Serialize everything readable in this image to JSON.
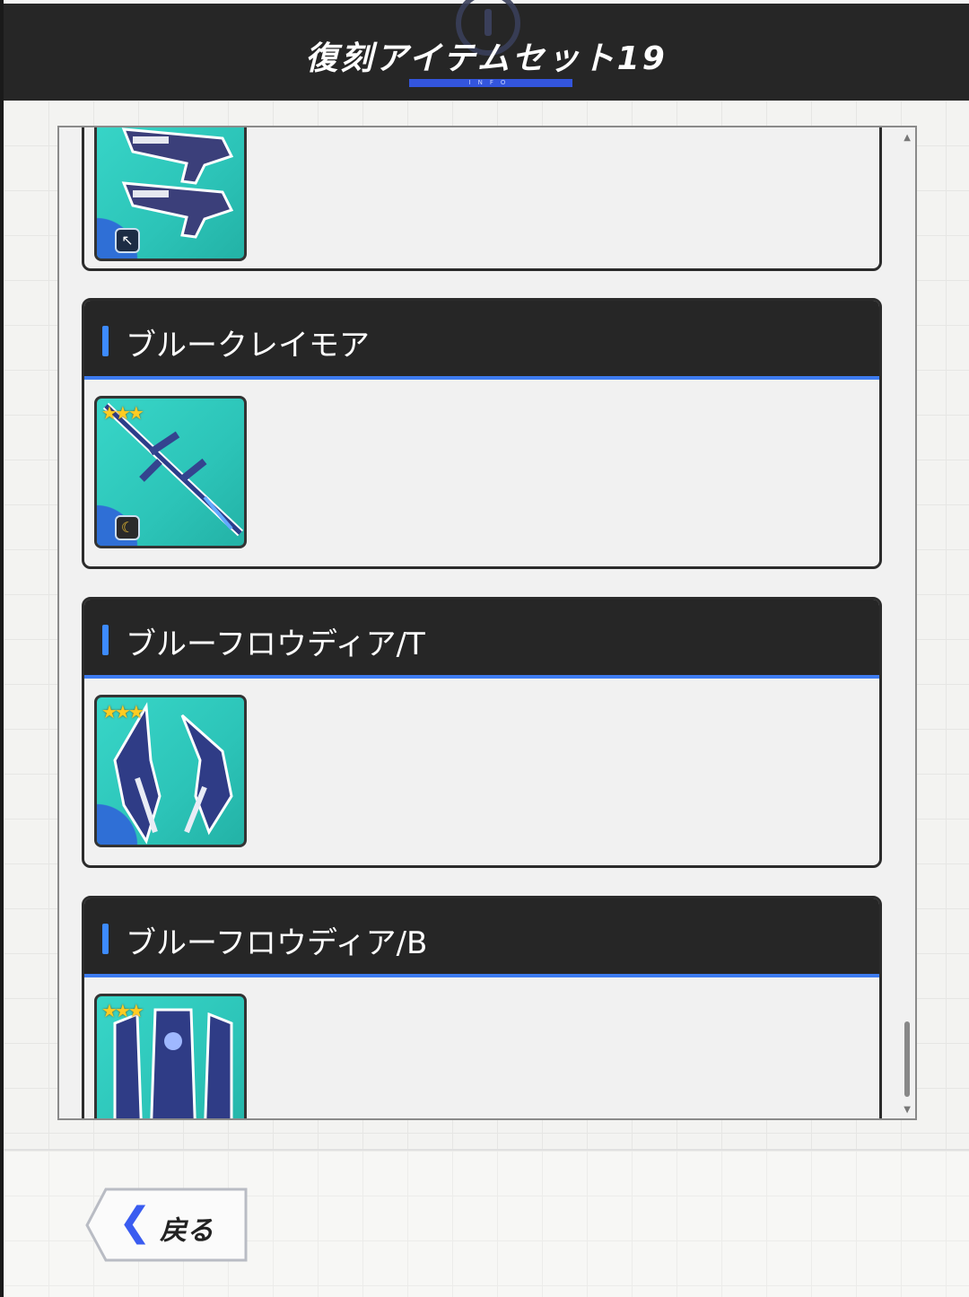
{
  "header": {
    "title": "復刻アイテムセット19",
    "info_label": "INFO"
  },
  "items": [
    {
      "name": "",
      "stars": "",
      "partial": true
    },
    {
      "name": "ブルークレイモア",
      "stars": "★★★"
    },
    {
      "name": "ブルーフロウディア/T",
      "stars": "★★★"
    },
    {
      "name": "ブルーフロウディア/B",
      "stars": "★★★"
    }
  ],
  "footer": {
    "back_label": "戻る",
    "back_icon": "chevron-left-icon"
  },
  "colors": {
    "accent": "#3d7bf0",
    "header_bg": "#262626",
    "icon_bg": "#2cc4b8"
  }
}
